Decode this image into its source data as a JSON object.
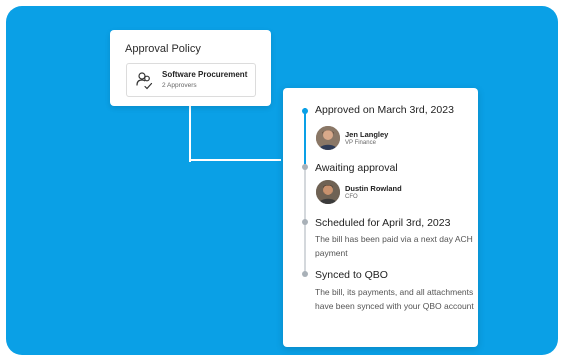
{
  "colors": {
    "background": "#0aa0e6",
    "accent": "#0aa0e6",
    "inactive_dot": "#a9b1b8"
  },
  "approval_policy": {
    "title": "Approval Policy",
    "policy": {
      "icon": "approvers-icon",
      "name": "Software Procurement",
      "approvers": "2 Approvers"
    }
  },
  "timeline": {
    "steps": [
      {
        "title": "Approved on March 3rd, 2023",
        "status": "active",
        "person": {
          "name": "Jen Langley",
          "role": "VP Finance"
        }
      },
      {
        "title": "Awaiting approval",
        "status": "pending",
        "person": {
          "name": "Dustin Rowland",
          "role": "CFO"
        }
      },
      {
        "title": "Scheduled for April 3rd, 2023",
        "status": "pending",
        "description": "The bill has been paid via a next day ACH payment"
      },
      {
        "title": "Synced to QBO",
        "status": "pending",
        "description": "The bill, its payments, and all attachments have been synced with your QBO account"
      }
    ]
  }
}
